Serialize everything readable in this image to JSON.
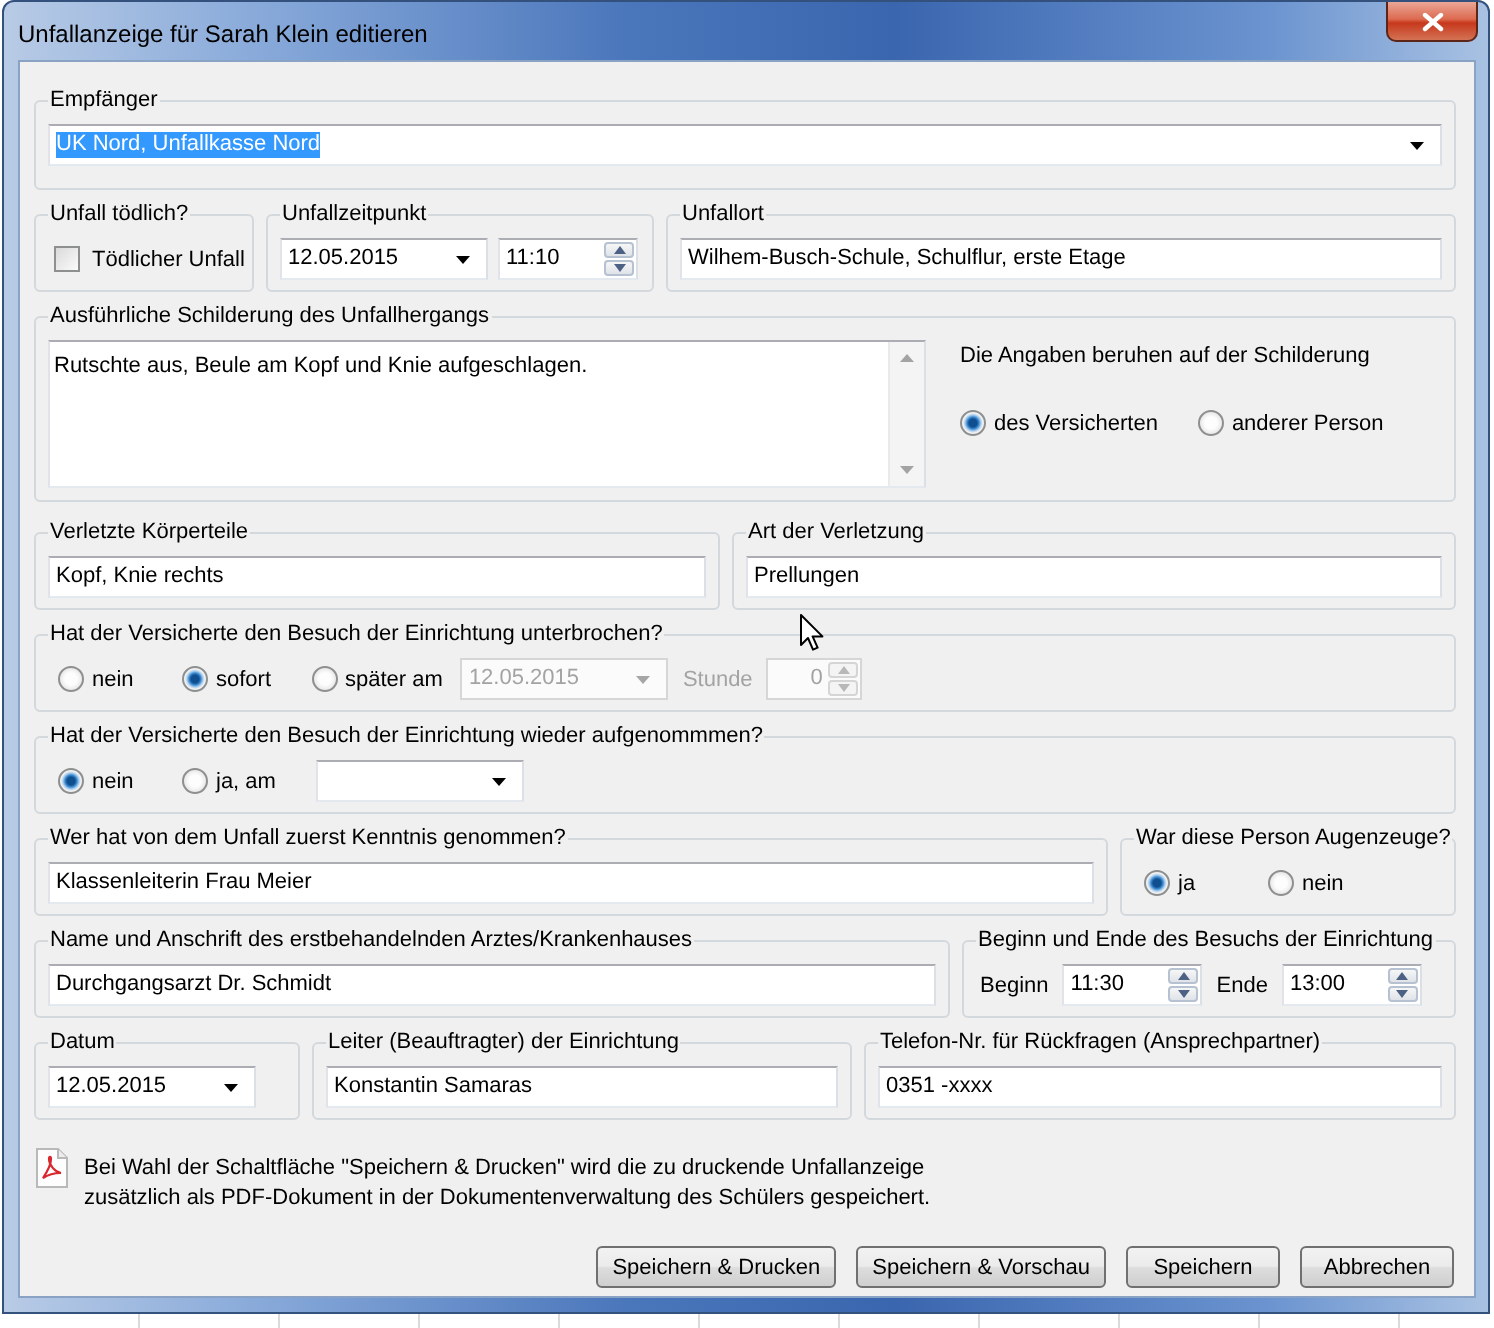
{
  "window": {
    "title": "Unfallanzeige für Sarah Klein editieren"
  },
  "rows": [
    {
      "groups": [
        {
          "label": "Empfänger",
          "controls": [
            {
              "kind": "combo",
              "value": "UK Nord, Unfallkasse Nord",
              "focused": true
            }
          ]
        }
      ]
    },
    {
      "groups": [
        {
          "label": "Unfall tödlich?",
          "controls": [
            {
              "kind": "checkbox",
              "label": "Tödlicher Unfall",
              "checked": false
            }
          ]
        },
        {
          "label": "Unfallzeitpunkt",
          "controls": [
            {
              "kind": "date",
              "value": "12.05.2015"
            },
            {
              "kind": "time",
              "value": "11:10"
            }
          ]
        },
        {
          "label": "Unfallort",
          "controls": [
            {
              "kind": "text",
              "value": "Wilhem-Busch-Schule, Schulflur, erste Etage"
            }
          ]
        }
      ]
    },
    {
      "groups": [
        {
          "label": "Ausführliche Schilderung des Unfallhergangs",
          "controls": [
            {
              "kind": "memo",
              "value": "Rutschte aus, Beule am Kopf und Knie aufgeschlagen."
            },
            {
              "kind": "choice",
              "label": "Die Angaben beruhen auf der Schilderung",
              "options": [
                {
                  "label": "des Versicherten",
                  "selected": true
                },
                {
                  "label": "anderer Person",
                  "selected": false
                }
              ]
            }
          ]
        }
      ]
    },
    {
      "groups": [
        {
          "label": "Verletzte Körperteile",
          "controls": [
            {
              "kind": "text",
              "value": "Kopf, Knie rechts"
            }
          ]
        },
        {
          "label": "Art der Verletzung",
          "controls": [
            {
              "kind": "text",
              "value": "Prellungen"
            }
          ]
        }
      ]
    },
    {
      "groups": [
        {
          "label": "Hat der Versicherte den Besuch der Einrichtung unterbrochen?",
          "controls": [
            {
              "kind": "radios",
              "disabled": false,
              "options": [
                {
                  "label": "nein",
                  "selected": false
                },
                {
                  "label": "sofort",
                  "selected": true
                },
                {
                  "label": "später am",
                  "selected": false
                }
              ]
            },
            {
              "kind": "date",
              "value": "12.05.2015",
              "disabled": true
            },
            {
              "kind": "caption",
              "text": "Stunde",
              "disabled": true
            },
            {
              "kind": "number",
              "value": "0",
              "disabled": true
            }
          ]
        }
      ]
    },
    {
      "groups": [
        {
          "label": "Hat der Versicherte den Besuch der Einrichtung wieder aufgenommmen?",
          "controls": [
            {
              "kind": "radios",
              "options": [
                {
                  "label": "nein",
                  "selected": true
                },
                {
                  "label": "ja, am",
                  "selected": false
                }
              ]
            },
            {
              "kind": "date"
            }
          ]
        }
      ]
    },
    {
      "groups": [
        {
          "label": "Wer hat von dem Unfall zuerst Kenntnis genommen?",
          "controls": [
            {
              "kind": "text",
              "value": "Klassenleiterin Frau Meier"
            }
          ]
        },
        {
          "label": "War diese Person Augenzeuge?",
          "controls": [
            {
              "kind": "radios",
              "options": [
                {
                  "label": "ja",
                  "selected": true
                },
                {
                  "label": "nein",
                  "selected": false
                }
              ]
            }
          ]
        }
      ]
    },
    {
      "groups": [
        {
          "label": "Name und Anschrift des erstbehandelnden Arztes/Krankenhauses",
          "controls": [
            {
              "kind": "text",
              "value": "Durchgangsarzt Dr. Schmidt"
            }
          ]
        },
        {
          "label": "Beginn und Ende des Besuchs der Einrichtung",
          "controls": [
            {
              "kind": "caption",
              "text": "Beginn"
            },
            {
              "kind": "time",
              "value": "11:30"
            },
            {
              "kind": "caption",
              "text": "Ende"
            },
            {
              "kind": "time",
              "value": "13:00"
            }
          ]
        }
      ]
    },
    {
      "groups": [
        {
          "label": "Datum",
          "controls": [
            {
              "kind": "date",
              "value": "12.05.2015"
            }
          ]
        },
        {
          "label": "Leiter (Beauftragter) der Einrichtung",
          "controls": [
            {
              "kind": "text",
              "value": "Konstantin Samaras"
            }
          ]
        },
        {
          "label": "Telefon-Nr. für Rückfragen (Ansprechpartner)",
          "controls": [
            {
              "kind": "text",
              "value": "0351 -xxxx"
            }
          ]
        }
      ]
    }
  ],
  "note": {
    "lines": [
      "Bei Wahl der Schaltfläche \"Speichern & Drucken\" wird die zu druckende Unfallanzeige",
      "zusätzlich als PDF-Dokument in der Dokumentenverwaltung des Schülers gespeichert."
    ]
  },
  "buttons": [
    {
      "label": "Speichern & Drucken"
    },
    {
      "label": "Speichern & Vorschau"
    },
    {
      "label": "Speichern"
    },
    {
      "label": "Abbrechen"
    }
  ]
}
